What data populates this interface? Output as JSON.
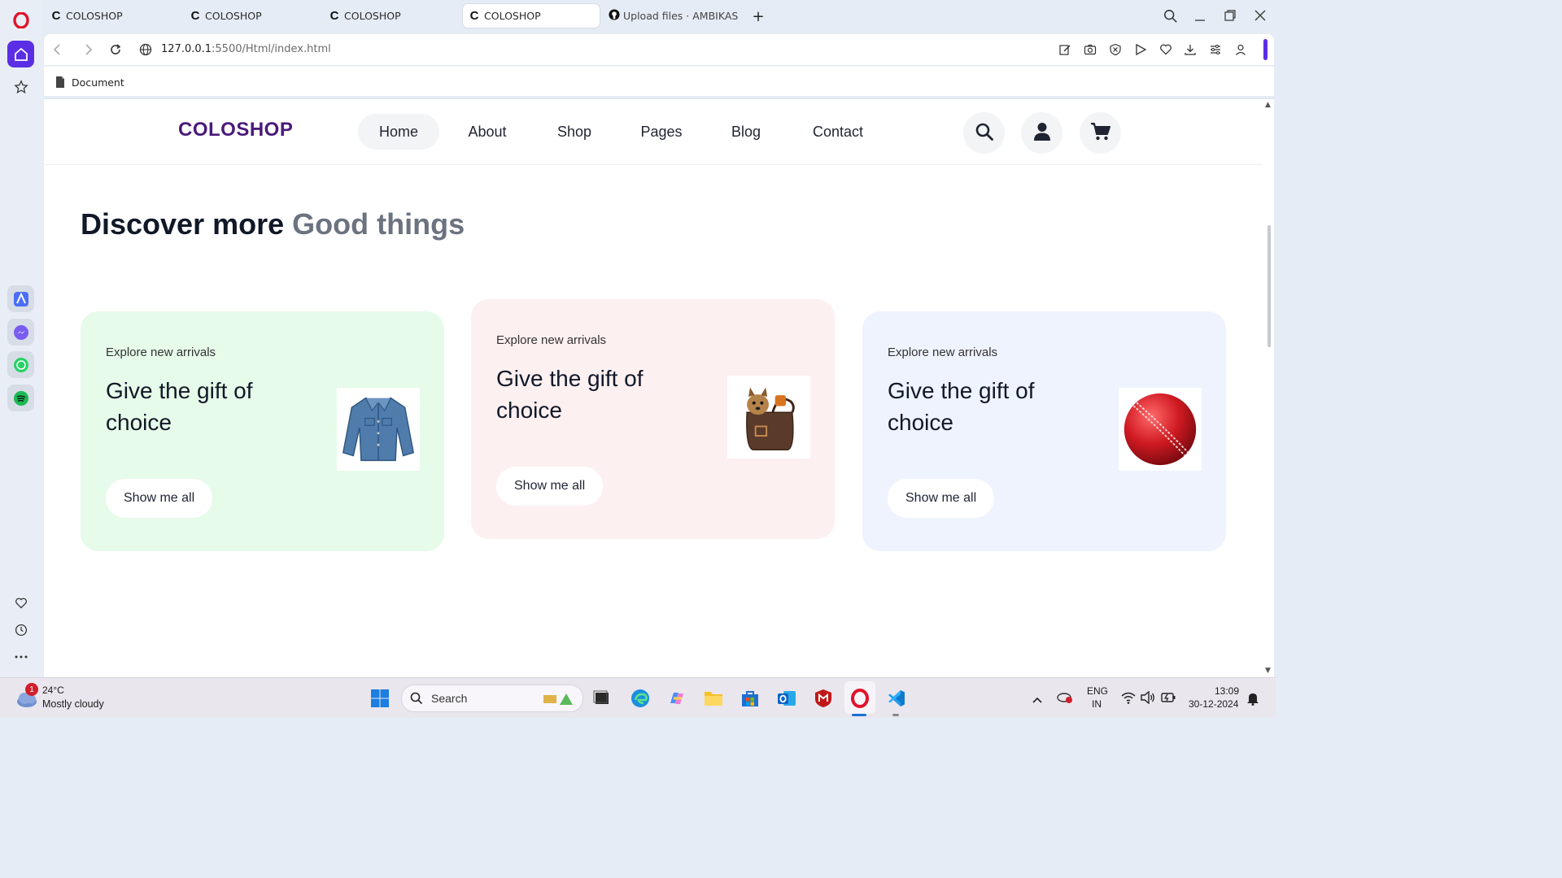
{
  "browser": {
    "tabs": [
      {
        "title": "COLOSHOP",
        "favicon": "C",
        "active": false
      },
      {
        "title": "COLOSHOP",
        "favicon": "C",
        "active": false
      },
      {
        "title": "COLOSHOP",
        "favicon": "C",
        "active": false
      },
      {
        "title": "COLOSHOP",
        "favicon": "C",
        "active": true
      },
      {
        "title": "Upload files · AMBIKASITH",
        "favicon": "github-icon",
        "active": false
      }
    ],
    "url_host": "127.0.0.1",
    "url_path": ":5500/Html/index.html",
    "bookmark_label": "Document"
  },
  "site": {
    "logo": "COLOSHOP",
    "nav": [
      "Home",
      "About",
      "Shop",
      "Pages",
      "Blog",
      "Contact"
    ],
    "active_nav": "Home",
    "heading_strong": "Discover more",
    "heading_muted": "Good things",
    "cards": [
      {
        "eyebrow": "Explore new arrivals",
        "headline": "Give the gift of choice",
        "button": "Show me all",
        "bg": "#e6fbe9",
        "product": "denim-jacket"
      },
      {
        "eyebrow": "Explore new arrivals",
        "headline": "Give the gift of choice",
        "button": "Show me all",
        "bg": "#fdf0f1",
        "product": "dog-in-bag"
      },
      {
        "eyebrow": "Explore new arrivals",
        "headline": "Give the gift of choice",
        "button": "Show me all",
        "bg": "#eef3fe",
        "product": "cricket-ball"
      }
    ]
  },
  "taskbar": {
    "weather_temp": "24°C",
    "weather_desc": "Mostly cloudy",
    "weather_badge": "1",
    "search_label": "Search",
    "lang_top": "ENG",
    "lang_bottom": "IN",
    "time": "13:09",
    "date": "30-12-2024"
  },
  "colors": {
    "logo": "#4a1a7a",
    "opera_red": "#e0132b",
    "sidebar_active": "#5b2ee6"
  }
}
